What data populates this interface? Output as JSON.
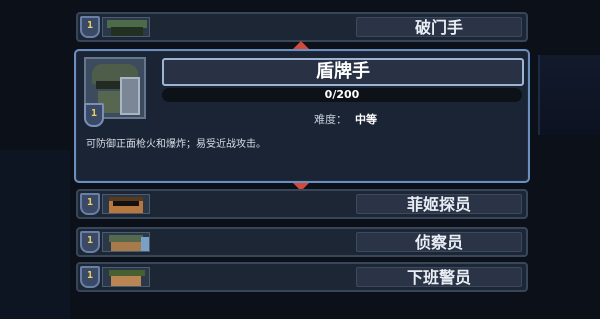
{
  "characters": [
    {
      "name": "破门手",
      "level": "1",
      "portrait": "green-helmet-soldier"
    },
    {
      "name": "菲姬探员",
      "level": "1",
      "portrait": "sunglasses-agent"
    },
    {
      "name": "侦察员",
      "level": "1",
      "portrait": "scout-goggles"
    },
    {
      "name": "下班警员",
      "level": "1",
      "portrait": "off-duty-cop"
    }
  ],
  "selected": {
    "name": "盾牌手",
    "level": "1",
    "portrait": "riot-shield-soldier",
    "progress_text": "0/200",
    "progress_fraction": 0.0,
    "difficulty_label": "难度：",
    "difficulty_value": "中等",
    "description": "可防御正面枪火和爆炸；易受近战攻击。"
  },
  "colors": {
    "accent": "#6c8fbe",
    "arrow": "#d24a3b",
    "level_text": "#f0d060"
  }
}
